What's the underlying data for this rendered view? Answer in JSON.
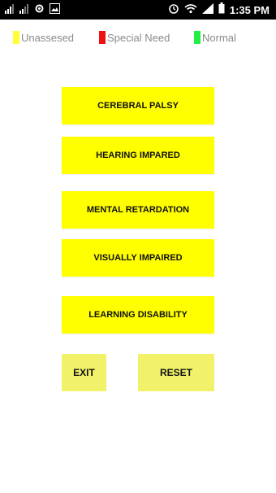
{
  "status_bar": {
    "time": "1:35 PM",
    "left_icons": [
      "signal-icon",
      "signal-icon",
      "settings-icon",
      "gallery-icon"
    ],
    "right_icons": [
      "alarm-icon",
      "wifi-icon",
      "cell-signal-icon",
      "battery-icon"
    ]
  },
  "legend": [
    {
      "label": "Unassesed",
      "color": "#ffff33"
    },
    {
      "label": "Special Need",
      "color": "#ee1111"
    },
    {
      "label": "Normal",
      "color": "#22ee44"
    }
  ],
  "categories": [
    {
      "label": "CEREBRAL PALSY",
      "status_color": "#ffff00"
    },
    {
      "label": "HEARING IMPARED",
      "status_color": "#ffff00"
    },
    {
      "label": "MENTAL RETARDATION",
      "status_color": "#ffff00"
    },
    {
      "label": "VISUALLY IMPAIRED",
      "status_color": "#ffff00"
    },
    {
      "label": "LEARNING DISABILITY",
      "status_color": "#ffff00"
    }
  ],
  "actions": {
    "exit_label": "EXIT",
    "reset_label": "RESET",
    "button_color": "#f2f26a"
  }
}
